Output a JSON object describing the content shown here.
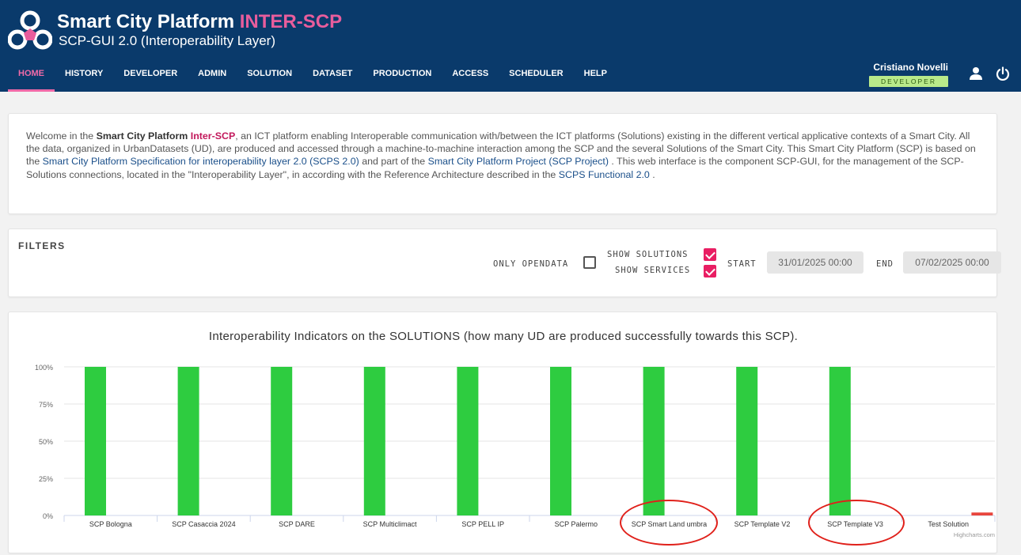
{
  "header": {
    "title_main": "Smart City Platform",
    "title_accent": "INTER-SCP",
    "subtitle": "SCP-GUI 2.0 (Interoperability Layer)",
    "logo_icon": "scp-logo-icon",
    "colors": {
      "bar": "#0a3a6b",
      "accent": "#e85d9c"
    }
  },
  "nav": {
    "items": [
      {
        "label": "HOME",
        "active": true
      },
      {
        "label": "HISTORY"
      },
      {
        "label": "DEVELOPER"
      },
      {
        "label": "ADMIN"
      },
      {
        "label": "SOLUTION"
      },
      {
        "label": "DATASET"
      },
      {
        "label": "PRODUCTION"
      },
      {
        "label": "ACCESS"
      },
      {
        "label": "SCHEDULER"
      },
      {
        "label": "HELP"
      }
    ]
  },
  "user": {
    "name": "Cristiano Novelli",
    "role": "DEVELOPER",
    "profile_icon": "user-icon",
    "logout_icon": "power-icon"
  },
  "welcome": {
    "t1": "Welcome in the ",
    "b1": "Smart City Platform ",
    "b2": "Inter-SCP",
    "t2": ", an ICT platform enabling Interoperable communication with/between the ICT platforms (Solutions) existing in the different vertical applicative contexts of a Smart City. All the data, organized in UrbanDatasets (UD), are produced and accessed through a machine-to-machine interaction among the SCP and the several Solutions of the Smart City. This Smart City Platform (SCP) is based on the ",
    "l1": "Smart City Platform Specification for interoperability layer 2.0 (SCPS 2.0)",
    "t3": " and part of the ",
    "l2": "Smart City Platform Project (SCP Project)",
    "t4": " . This web interface is the component SCP-GUI, for the management of the SCP-Solutions connections, located in the \"Interoperability Layer\", in according with the Reference Architecture described in the ",
    "l3": "SCPS Functional 2.0",
    "t5": " ."
  },
  "filters": {
    "title": "FILTERS",
    "only_opendata_label": "ONLY OPENDATA",
    "only_opendata": false,
    "show_solutions_label": "SHOW SOLUTIONS",
    "show_solutions": true,
    "show_services_label": "SHOW SERVICES",
    "show_services": true,
    "start_label": "START",
    "start_value": "31/01/2025 00:00",
    "end_label": "END",
    "end_value": "07/02/2025 00:00"
  },
  "chart_data": {
    "type": "bar",
    "title": "Interoperability Indicators on the SOLUTIONS (how many UD are produced successfully towards this SCP).",
    "categories": [
      "SCP Bologna",
      "SCP Casaccia 2024",
      "SCP DARE",
      "SCP Multiclimact",
      "SCP PELL IP",
      "SCP Palermo",
      "SCP Smart Land umbra",
      "SCP Template V2",
      "SCP Template V3",
      "Test Solution"
    ],
    "series": [
      {
        "color": "#2ecc40",
        "values": [
          100,
          100,
          100,
          100,
          100,
          100,
          100,
          100,
          100,
          0
        ]
      },
      {
        "color": "#e8453c",
        "values": [
          0,
          0,
          0,
          0,
          0,
          0,
          0,
          0,
          0,
          2
        ]
      }
    ],
    "yticks": [
      "0%",
      "25%",
      "50%",
      "75%",
      "100%"
    ],
    "ylim": [
      0,
      100
    ],
    "grid": true,
    "legend": "none",
    "credits": "Highcharts.com",
    "highlighted_categories": [
      "SCP Smart Land umbra",
      "SCP Template V3"
    ]
  }
}
